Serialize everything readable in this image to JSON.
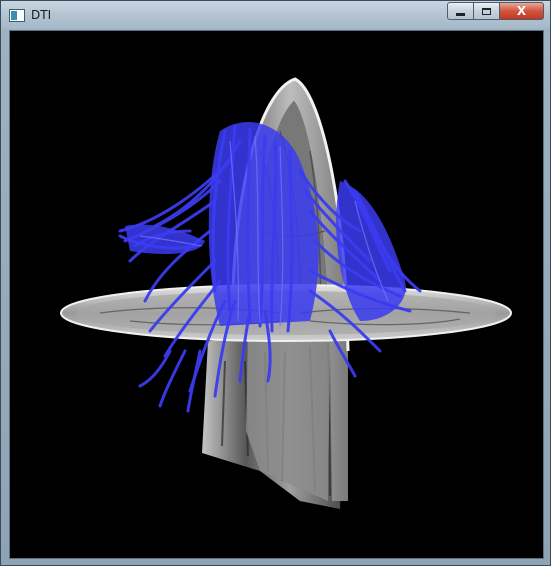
{
  "window": {
    "title": "DTI"
  },
  "caption_buttons": {
    "minimize_icon": "minimize-icon",
    "maximize_icon": "maximize-icon",
    "close_label": "X"
  },
  "colors": {
    "fibers": "#3b3cf0",
    "background": "#000000",
    "slices": "#c8c8c8"
  }
}
